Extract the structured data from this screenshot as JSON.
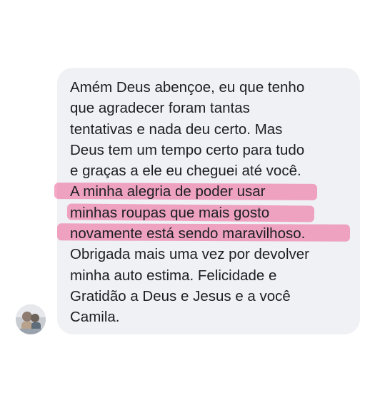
{
  "message": {
    "lines": [
      "Amém Deus abençoe, eu que tenho",
      "que agradecer foram tantas",
      "tentativas e nada deu certo. Mas",
      "Deus tem um tempo certo para tudo",
      "e graças a ele eu cheguei até você.",
      "A minha alegria de poder usar",
      "minhas roupas que mais gosto",
      "novamente está sendo maravilhoso.",
      "Obrigada mais uma vez por devolver",
      "minha auto estima. Felicidade e",
      "Gratidão a Deus e Jesus e a você",
      "Camila."
    ],
    "highlighted_lines": [
      6,
      7,
      8
    ]
  },
  "colors": {
    "bubble": "#eff1f4",
    "text": "#1c1e21",
    "highlight": "#ec6096"
  },
  "icons": {
    "avatar": "sender-avatar-photo"
  }
}
